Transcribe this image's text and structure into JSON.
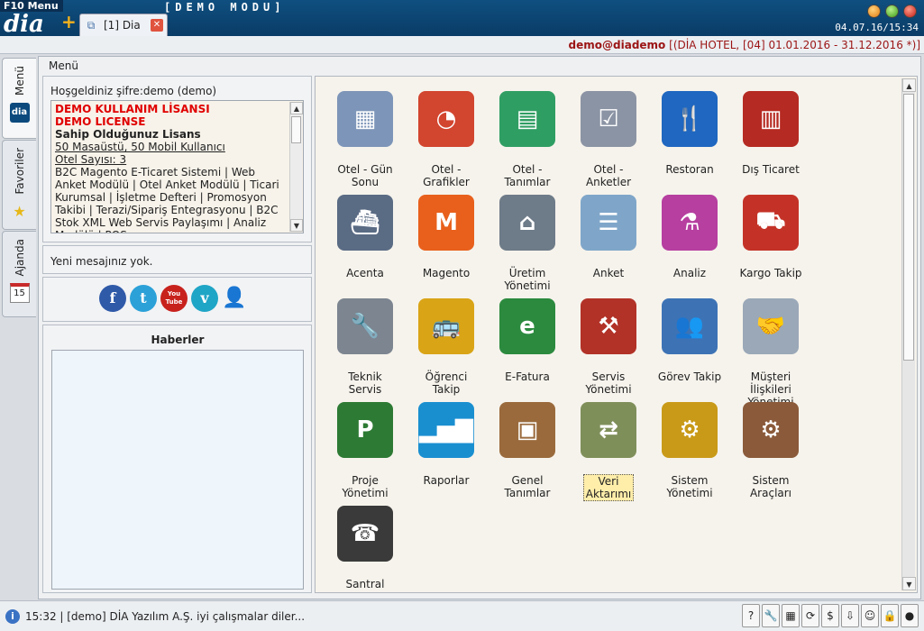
{
  "titlebar": {
    "menu_key": "F10 Menu",
    "mode": "[DEMO MODU]",
    "logo": "dia",
    "tab_label": "[1] Dia",
    "clock": "04.07.16/15:34"
  },
  "infobar": {
    "user": "demo@diademo",
    "firm": "[(DİA HOTEL, [04] 01.01.2016 - 31.12.2016 *)]"
  },
  "vtabs": [
    {
      "label": "Menü"
    },
    {
      "label": "Favoriler"
    },
    {
      "label": "Ajanda",
      "badge": "15"
    }
  ],
  "menu_caption": "Menü",
  "welcome": {
    "title": "Hoşgeldiniz şifre:demo (demo)",
    "license_red1": "DEMO KULLANIM LİSANSI",
    "license_red2": "DEMO LICENSE",
    "license_heading": "Sahip Olduğunuz Lisans",
    "users": "50 Masaüstü, 50 Mobil Kullanıcı",
    "hotel_count": "Otel Sayısı: 3",
    "modules": "B2C Magento E-Ticaret Sistemi | Web Anket Modülü | Otel Anket Modülü | Ticari Kurumsal | İşletme Defteri | Promosyon Takibi | Terazi/Sipariş Entegrasyonu | B2C Stok XML Web Servis Paylaşımı | Analiz Modülü | POS"
  },
  "message": "Yeni mesajınız yok.",
  "social": [
    {
      "name": "facebook",
      "glyph": "f",
      "color": "#2f5aa8"
    },
    {
      "name": "twitter",
      "glyph": "t",
      "color": "#2ba1d8"
    },
    {
      "name": "youtube",
      "glyph": "You Tube",
      "color": "#c8221d"
    },
    {
      "name": "vimeo",
      "glyph": "v",
      "color": "#1fa5c6"
    }
  ],
  "news_title": "Haberler",
  "tiles": [
    {
      "label": "Otel - Gün\nSonu",
      "icon": "calendar-grid-icon",
      "glyph": "▦",
      "color": "#7d95b8"
    },
    {
      "label": "Otel -\nGrafikler",
      "icon": "pie-chart-icon",
      "glyph": "◔",
      "color": "#d2452f"
    },
    {
      "label": "Otel -\nTanımlar",
      "icon": "stacked-folders-icon",
      "glyph": "▤",
      "color": "#2f9e63"
    },
    {
      "label": "Otel -\nAnketler",
      "icon": "checklist-icon",
      "glyph": "☑",
      "color": "#8b94a4"
    },
    {
      "label": "Restoran",
      "icon": "fork-knife-icon",
      "glyph": "🍴",
      "color": "#1f67c0"
    },
    {
      "label": "Dış Ticaret",
      "icon": "shipping-container-icon",
      "glyph": "▥",
      "color": "#b52a22"
    },
    {
      "label": "Acenta",
      "icon": "ship-icon",
      "glyph": "⛴",
      "color": "#5a6b84"
    },
    {
      "label": "Magento",
      "icon": "magento-icon",
      "glyph": "M",
      "color": "#e8601c"
    },
    {
      "label": "Üretim\nYönetimi",
      "icon": "factory-icon",
      "glyph": "⌂",
      "color": "#6e7b88"
    },
    {
      "label": "Anket",
      "icon": "survey-document-icon",
      "glyph": "☰",
      "color": "#7fa6c9"
    },
    {
      "label": "Analiz",
      "icon": "test-tubes-icon",
      "glyph": "⚗",
      "color": "#b63fa0"
    },
    {
      "label": "Kargo Takip",
      "icon": "truck-icon",
      "glyph": "⛟",
      "color": "#c43227"
    },
    {
      "label": "Teknik\nServis",
      "icon": "wrench-icon",
      "glyph": "🔧",
      "color": "#7c8590"
    },
    {
      "label": "Öğrenci\nTakip",
      "icon": "school-bus-icon",
      "glyph": "🚌",
      "color": "#d9a416"
    },
    {
      "label": "E-Fatura",
      "icon": "e-fatura-icon",
      "glyph": "e",
      "color": "#2b8a3e"
    },
    {
      "label": "Servis\nYönetimi",
      "icon": "tools-cross-icon",
      "glyph": "⚒",
      "color": "#b23228"
    },
    {
      "label": "Görev Takip",
      "icon": "people-icon",
      "glyph": "👥",
      "color": "#3d73b5"
    },
    {
      "label": "Müşteri\nİlişkileri\nYönetimi",
      "icon": "handshake-icon",
      "glyph": "🤝",
      "color": "#9aa8b8"
    },
    {
      "label": "Proje\nYönetimi",
      "icon": "project-p-icon",
      "glyph": "P",
      "color": "#2d7a34"
    },
    {
      "label": "Raporlar",
      "icon": "bar-chart-icon",
      "glyph": "▂▅▇",
      "color": "#1a8fd0"
    },
    {
      "label": "Genel\nTanımlar",
      "icon": "open-box-icon",
      "glyph": "▣",
      "color": "#9a6a3c"
    },
    {
      "label": "Veri\nAktarımı",
      "icon": "data-transfer-icon",
      "glyph": "⇄",
      "color": "#7f8f5a",
      "selected": true
    },
    {
      "label": "Sistem\nYönetimi",
      "icon": "gears-icon",
      "glyph": "⚙",
      "color": "#c99a18"
    },
    {
      "label": "Sistem\nAraçları",
      "icon": "gear-box-icon",
      "glyph": "⚙",
      "color": "#8a5a3a"
    },
    {
      "label": "Santral",
      "icon": "telephone-icon",
      "glyph": "☎",
      "color": "#3a3a3a"
    }
  ],
  "status": {
    "text": "15:32 | [demo] DİA Yazılım A.Ş. iyi çalışmalar diler...",
    "tools": [
      {
        "name": "help-icon",
        "glyph": "?"
      },
      {
        "name": "settings-tools-icon",
        "glyph": "🔧"
      },
      {
        "name": "calculator-icon",
        "glyph": "▦"
      },
      {
        "name": "refresh-icon",
        "glyph": "⟳"
      },
      {
        "name": "currency-icon",
        "glyph": "$"
      },
      {
        "name": "download-icon",
        "glyph": "⇩"
      },
      {
        "name": "smiley-icon",
        "glyph": "☺"
      },
      {
        "name": "lock-icon",
        "glyph": "🔒"
      },
      {
        "name": "power-icon",
        "glyph": "●"
      }
    ]
  }
}
